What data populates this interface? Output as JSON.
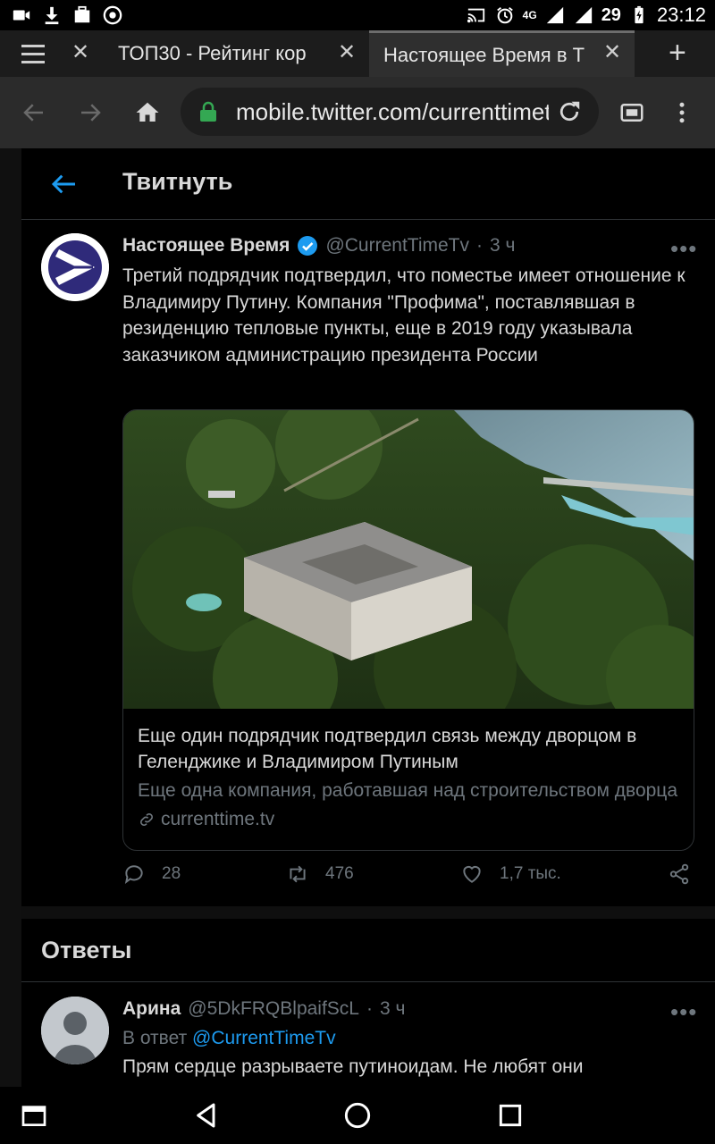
{
  "status_bar": {
    "network_label": "4G",
    "battery_percent": "29",
    "time": "23:12"
  },
  "tabs": [
    {
      "title": "ТОП30 - Рейтинг кор"
    },
    {
      "title": "Настоящее Время в Т",
      "active": true
    }
  ],
  "address_bar": {
    "url": "mobile.twitter.com/currenttimet"
  },
  "page": {
    "header_title": "Твитнуть",
    "tweet": {
      "author_name": "Настоящее Время",
      "handle": "@CurrentTimeTv",
      "separator": "·",
      "time": "3 ч",
      "text": "Третий подрядчик подтвердил, что поместье имеет отношение к Владимиру Путину. Компания \"Профима\", поставлявшая в резиденцию тепловые пункты, еще в 2019 году указывала заказчиком администрацию президента России",
      "card": {
        "title": "Еще один подрядчик подтвердил связь между дворцом в Геленджике и Владимиром Путиным",
        "description": "Еще одна компания, работавшая над строительством дворца",
        "domain": "currenttime.tv"
      },
      "stats": {
        "replies": "28",
        "retweets": "476",
        "likes": "1,7 тыс."
      }
    },
    "replies_title": "Ответы",
    "reply": {
      "author_name": "Арина",
      "handle": "@5DkFRQBlpaifScL",
      "separator": "·",
      "time": "3 ч",
      "reply_prefix": "В ответ",
      "reply_to": "@CurrentTimeTv",
      "text": "Прям сердце разрываете  путиноидам. Не любят они"
    }
  },
  "colors": {
    "accent": "#1d9bf0",
    "muted": "#6e767d",
    "background": "#000000"
  }
}
